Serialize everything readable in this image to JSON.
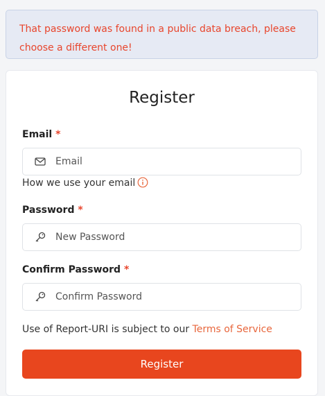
{
  "alert": {
    "message": "That password was found in a public data breach, please choose a different one!"
  },
  "form": {
    "title": "Register",
    "email": {
      "label": "Email",
      "required_mark": "*",
      "placeholder": "Email",
      "help_text": "How we use your email",
      "icon": "envelope-icon"
    },
    "password": {
      "label": "Password",
      "required_mark": "*",
      "placeholder": "New Password",
      "icon": "key-icon"
    },
    "confirm_password": {
      "label": "Confirm Password",
      "required_mark": "*",
      "placeholder": "Confirm Password",
      "icon": "key-icon"
    },
    "terms_prefix": "Use of Report-URI is subject to our",
    "terms_link": "Terms of Service",
    "submit_label": "Register"
  },
  "colors": {
    "accent": "#e8461e",
    "error_text": "#e8452c",
    "alert_bg": "#e6eaf4"
  }
}
